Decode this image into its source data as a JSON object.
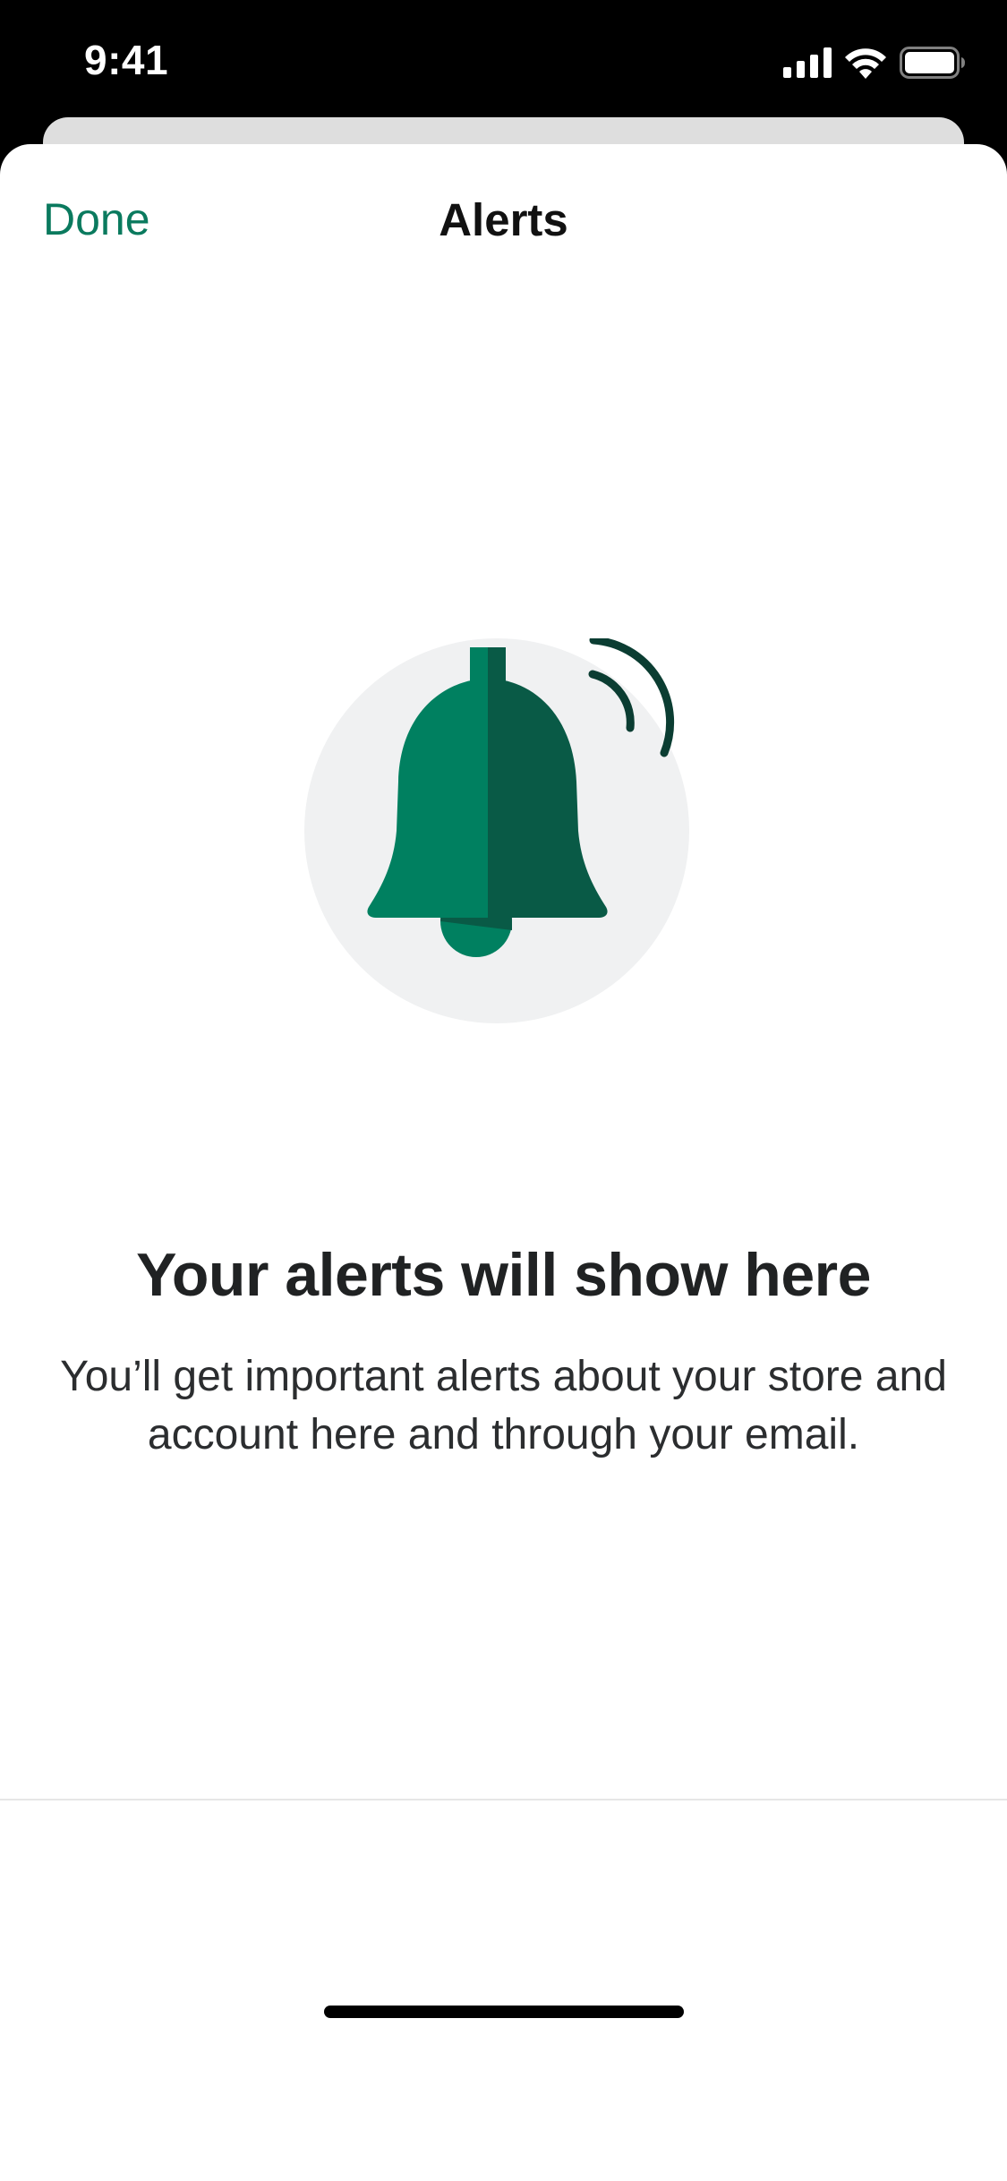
{
  "status_bar": {
    "time": "9:41",
    "icons": [
      "cellular-signal-icon",
      "wifi-icon",
      "battery-icon"
    ]
  },
  "nav": {
    "done_label": "Done",
    "title": "Alerts"
  },
  "empty_state": {
    "illustration": "ringing-bell-icon",
    "title": "Your alerts will show here",
    "description": "You’ll get important alerts about your store and account here and through your email."
  },
  "colors": {
    "accent": "#0a7a5e",
    "bell_light": "#008060",
    "bell_dark": "#095a46",
    "circle": "#f0f1f2"
  }
}
